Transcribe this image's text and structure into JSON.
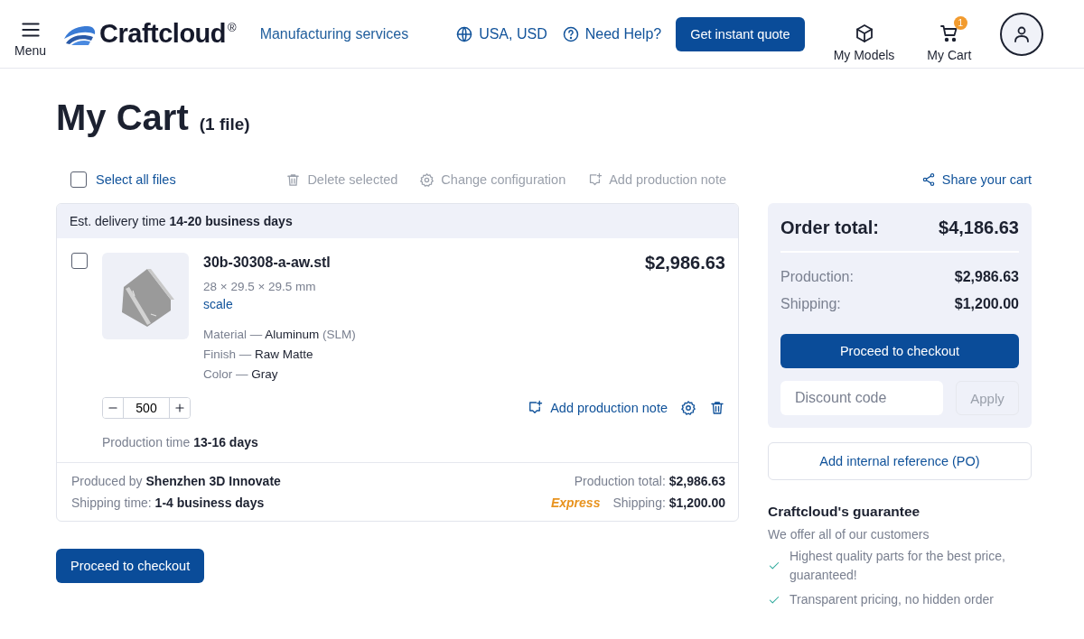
{
  "header": {
    "menu_label": "Menu",
    "logo_text": "Craftcloud",
    "logo_mark": "®",
    "nav_link": "Manufacturing services",
    "locale": "USA, USD",
    "help": "Need Help?",
    "quote_button": "Get instant quote",
    "models_label": "My Models",
    "cart_label": "My Cart",
    "cart_badge": "1"
  },
  "page": {
    "title": "My Cart",
    "file_count": "(1 file)"
  },
  "toolbar": {
    "select_all": {
      "label": "Select all files",
      "checked": false
    },
    "actions": [
      {
        "kind": "delete",
        "label": "Delete selected",
        "disabled": true
      },
      {
        "kind": "configure",
        "label": "Change configuration",
        "disabled": true
      },
      {
        "kind": "note",
        "label": "Add production note",
        "disabled": true
      }
    ],
    "share": "Share your cart"
  },
  "group": {
    "delivery": "Est. delivery time **14-20 business days**",
    "items": [
      {
        "checked": false,
        "filename": "30b-30308-a-aw.stl",
        "dimensions": "28 × 29.5 × 29.5 mm",
        "scale_link": "scale",
        "price": "$2,986.63",
        "specs": [
          {
            "label": "Material —",
            "value": "Aluminum",
            "note": "(SLM)"
          },
          {
            "label": "Finish —",
            "value": "Raw Matte"
          },
          {
            "label": "Color —",
            "value": "Gray"
          }
        ],
        "quantity": "500",
        "note_link": "Add production note",
        "production_time": "Production time **13-16 days**"
      }
    ],
    "produced_by": "Produced by **Shenzhen 3D Innovate**",
    "shipping_time": "Shipping time: **1-4 business days**",
    "production_total": "Production total: **$2,986.63**",
    "shipping_speed": "Express",
    "shipping_cost": "Shipping: **$1,200.00**"
  },
  "checkout_button": "Proceed to checkout",
  "summary": {
    "title": "Order total:",
    "total": "$4,186.63",
    "lines": [
      {
        "label": "Production:",
        "value": "$2,986.63"
      },
      {
        "label": "Shipping:",
        "value": "$1,200.00"
      }
    ],
    "checkout_button": "Proceed to checkout",
    "discount_placeholder": "Discount code",
    "apply_button": {
      "label": "Apply",
      "disabled": true
    },
    "po_button": "Add internal reference (PO)"
  },
  "guarantee": {
    "title": "Craftcloud's guarantee",
    "intro": "We offer all of our customers",
    "items": [
      "Highest quality parts for the best price, guaranteed!",
      "Transparent pricing, no hidden order"
    ]
  }
}
